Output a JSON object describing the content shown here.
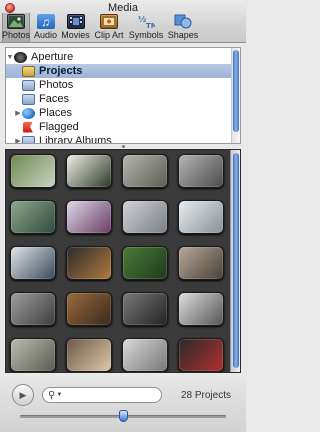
{
  "window": {
    "title": "Media"
  },
  "toolbar": {
    "items": [
      {
        "label": "Photos",
        "icon": "photos-icon",
        "selected": true
      },
      {
        "label": "Audio",
        "icon": "audio-icon",
        "selected": false
      },
      {
        "label": "Movies",
        "icon": "movies-icon",
        "selected": false
      },
      {
        "label": "Clip Art",
        "icon": "clipart-icon",
        "selected": false
      },
      {
        "label": "Symbols",
        "icon": "symbols-icon",
        "selected": false
      },
      {
        "label": "Shapes",
        "icon": "shapes-icon",
        "selected": false
      }
    ]
  },
  "source_list": {
    "items": [
      {
        "label": "Aperture",
        "icon": "aperture-icon",
        "disclosure": "expanded",
        "indent": 0,
        "selected": false
      },
      {
        "label": "Projects",
        "icon": "projects-icon",
        "disclosure": "none",
        "indent": 1,
        "selected": true
      },
      {
        "label": "Photos",
        "icon": "photos-album-icon",
        "disclosure": "none",
        "indent": 1,
        "selected": false
      },
      {
        "label": "Faces",
        "icon": "faces-icon",
        "disclosure": "none",
        "indent": 1,
        "selected": false
      },
      {
        "label": "Places",
        "icon": "places-icon",
        "disclosure": "collapsed",
        "indent": 1,
        "selected": false
      },
      {
        "label": "Flagged",
        "icon": "flag-icon",
        "disclosure": "none",
        "indent": 1,
        "selected": false
      },
      {
        "label": "Library Albums",
        "icon": "library-albums-icon",
        "disclosure": "collapsed",
        "indent": 1,
        "selected": false
      }
    ]
  },
  "browser": {
    "thumbnails": [
      {
        "colors": [
          "#6f8a55",
          "#c9d2c0"
        ]
      },
      {
        "colors": [
          "#f0efe8",
          "#2d3a2a"
        ]
      },
      {
        "colors": [
          "#b6b6ad",
          "#5b5d55"
        ]
      },
      {
        "colors": [
          "#b3b3b3",
          "#4d4d4d"
        ]
      },
      {
        "colors": [
          "#8fa78f",
          "#2e4a3a"
        ]
      },
      {
        "colors": [
          "#ddd9e6",
          "#6b3c66"
        ]
      },
      {
        "colors": [
          "#cfd1d4",
          "#7a7f86"
        ]
      },
      {
        "colors": [
          "#e6ecef",
          "#8a8f95"
        ]
      },
      {
        "colors": [
          "#dfe4ea",
          "#3c4a57"
        ]
      },
      {
        "colors": [
          "#2b2b2b",
          "#b07a3c"
        ]
      },
      {
        "colors": [
          "#4d7a3a",
          "#1c3a1a"
        ]
      },
      {
        "colors": [
          "#b7a99a",
          "#4a4038"
        ]
      },
      {
        "colors": [
          "#9e9e9e",
          "#3d3d3d"
        ]
      },
      {
        "colors": [
          "#9a6a40",
          "#3a2a1a"
        ]
      },
      {
        "colors": [
          "#7a7a7a",
          "#222222"
        ]
      },
      {
        "colors": [
          "#dedede",
          "#555555"
        ]
      },
      {
        "colors": [
          "#b9bcae",
          "#5a5c50"
        ]
      },
      {
        "colors": [
          "#6a5a4a",
          "#e0c8a8"
        ]
      },
      {
        "colors": [
          "#d9d9d9",
          "#777777"
        ]
      },
      {
        "colors": [
          "#2a2a2a",
          "#b03030"
        ]
      }
    ]
  },
  "footer": {
    "search_placeholder": "",
    "count_label": "28 Projects",
    "zoom_level": 0.5
  },
  "colors": {
    "selection": "#a9bedd",
    "scrollbar_accent": "#3c6fc4",
    "browser_bg": "#3a3a3a"
  }
}
